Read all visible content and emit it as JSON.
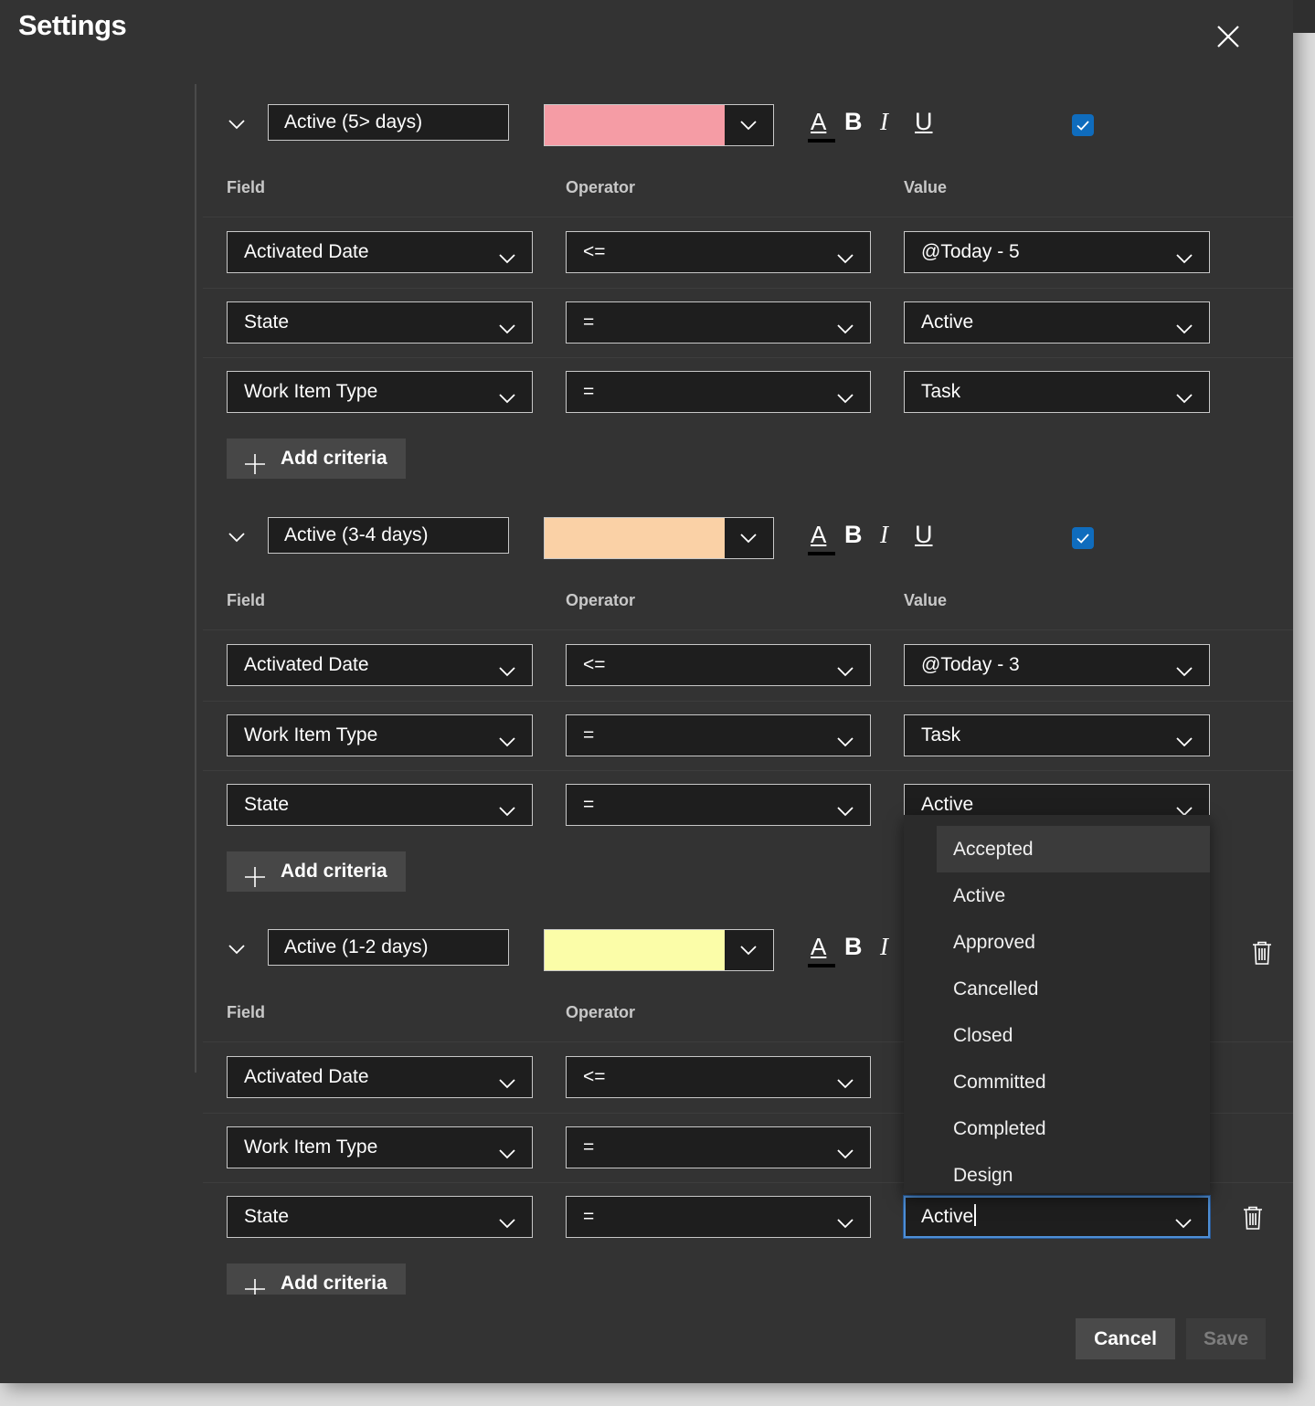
{
  "dialog": {
    "title": "Settings",
    "close_icon": "close-icon"
  },
  "columns": {
    "field": "Field",
    "operator": "Operator",
    "value": "Value"
  },
  "add_criteria_label": "Add criteria",
  "rules": [
    {
      "name": "Active (5> days)",
      "color": "#f59ca5",
      "enabled": true,
      "criteria": [
        {
          "field": "Activated Date",
          "operator": "<=",
          "value": "@Today - 5"
        },
        {
          "field": "State",
          "operator": "=",
          "value": "Active"
        },
        {
          "field": "Work Item Type",
          "operator": "=",
          "value": "Task"
        }
      ]
    },
    {
      "name": "Active (3-4 days)",
      "color": "#fad1a6",
      "enabled": true,
      "criteria": [
        {
          "field": "Activated Date",
          "operator": "<=",
          "value": "@Today - 3"
        },
        {
          "field": "Work Item Type",
          "operator": "=",
          "value": "Task"
        },
        {
          "field": "State",
          "operator": "=",
          "value": "Active"
        }
      ]
    },
    {
      "name": "Active (1-2 days)",
      "color": "#fbfda8",
      "criteria": [
        {
          "field": "Activated Date",
          "operator": "<="
        },
        {
          "field": "Work Item Type",
          "operator": "="
        },
        {
          "field": "State",
          "operator": "=",
          "value": "Active"
        }
      ]
    }
  ],
  "format_buttons": {
    "font_color": "A",
    "bold": "B",
    "italic": "I",
    "underline": "U"
  },
  "state_dropdown": {
    "options": [
      "Accepted",
      "Active",
      "Approved",
      "Cancelled",
      "Closed",
      "Committed",
      "Completed",
      "Design"
    ],
    "highlighted": "Accepted"
  },
  "footer": {
    "cancel": "Cancel",
    "save": "Save"
  }
}
